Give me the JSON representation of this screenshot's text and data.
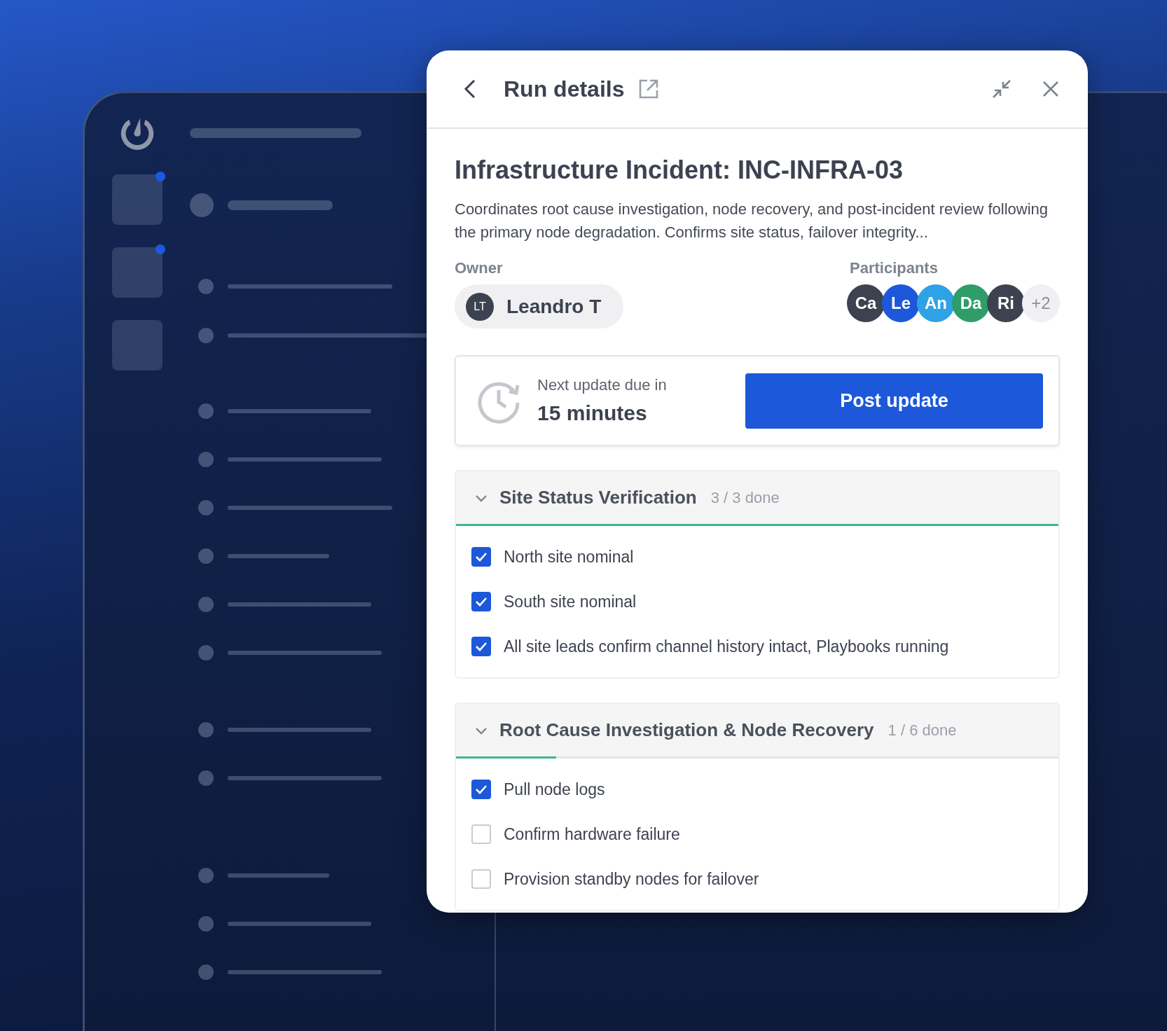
{
  "header": {
    "title": "Run details"
  },
  "run": {
    "title": "Infrastructure Incident: INC-INFRA-03",
    "description": "Coordinates root cause investigation, node recovery, and post-incident review following the primary node degradation. Confirms site status, failover integrity..."
  },
  "owner": {
    "label": "Owner",
    "initials": "LT",
    "name": "Leandro T"
  },
  "participants": {
    "label": "Participants",
    "avatars": [
      {
        "initials": "Ca",
        "color": "#3d4250"
      },
      {
        "initials": "Le",
        "color": "#1c58d9"
      },
      {
        "initials": "An",
        "color": "#2fa2e6"
      },
      {
        "initials": "Da",
        "color": "#2e9d6a"
      },
      {
        "initials": "Ri",
        "color": "#3d4250"
      }
    ],
    "more": "+2"
  },
  "update": {
    "label": "Next update due in",
    "value": "15 minutes",
    "button": "Post update"
  },
  "checklists": [
    {
      "title": "Site Status Verification",
      "count": "3 / 3 done",
      "expanded": true,
      "level": 1,
      "items": [
        {
          "label": "North site nominal",
          "checked": true
        },
        {
          "label": "South site nominal",
          "checked": true
        },
        {
          "label": "All site leads confirm channel history intact, Playbooks running",
          "checked": true
        }
      ]
    },
    {
      "title": "Root Cause Investigation & Node Recovery",
      "count": "1 / 6 done",
      "expanded": true,
      "level": 0.1667,
      "items": [
        {
          "label": "Pull node logs",
          "checked": true
        },
        {
          "label": "Confirm hardware failure",
          "checked": false
        },
        {
          "label": "Provision standby nodes for failover",
          "checked": false
        }
      ]
    }
  ]
}
